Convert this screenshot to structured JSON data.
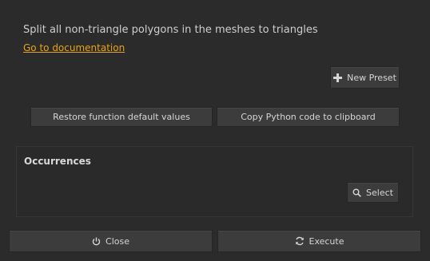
{
  "description": "Split all non-triangle polygons in the meshes to triangles",
  "documentation_link": "Go to documentation",
  "toolbar": {
    "new_preset_label": "New Preset",
    "new_preset_icon": "plus-icon"
  },
  "actions": {
    "restore_label": "Restore function default values",
    "copy_label": "Copy Python code to clipboard"
  },
  "occurrences": {
    "title": "Occurrences",
    "select_label": "Select",
    "select_icon": "search-icon"
  },
  "footer": {
    "close_label": "Close",
    "close_icon": "power-icon",
    "execute_label": "Execute",
    "execute_icon": "refresh-icon"
  },
  "colors": {
    "background": "#2b2b2b",
    "link": "#e8a317",
    "button": "#3c3c3c"
  }
}
